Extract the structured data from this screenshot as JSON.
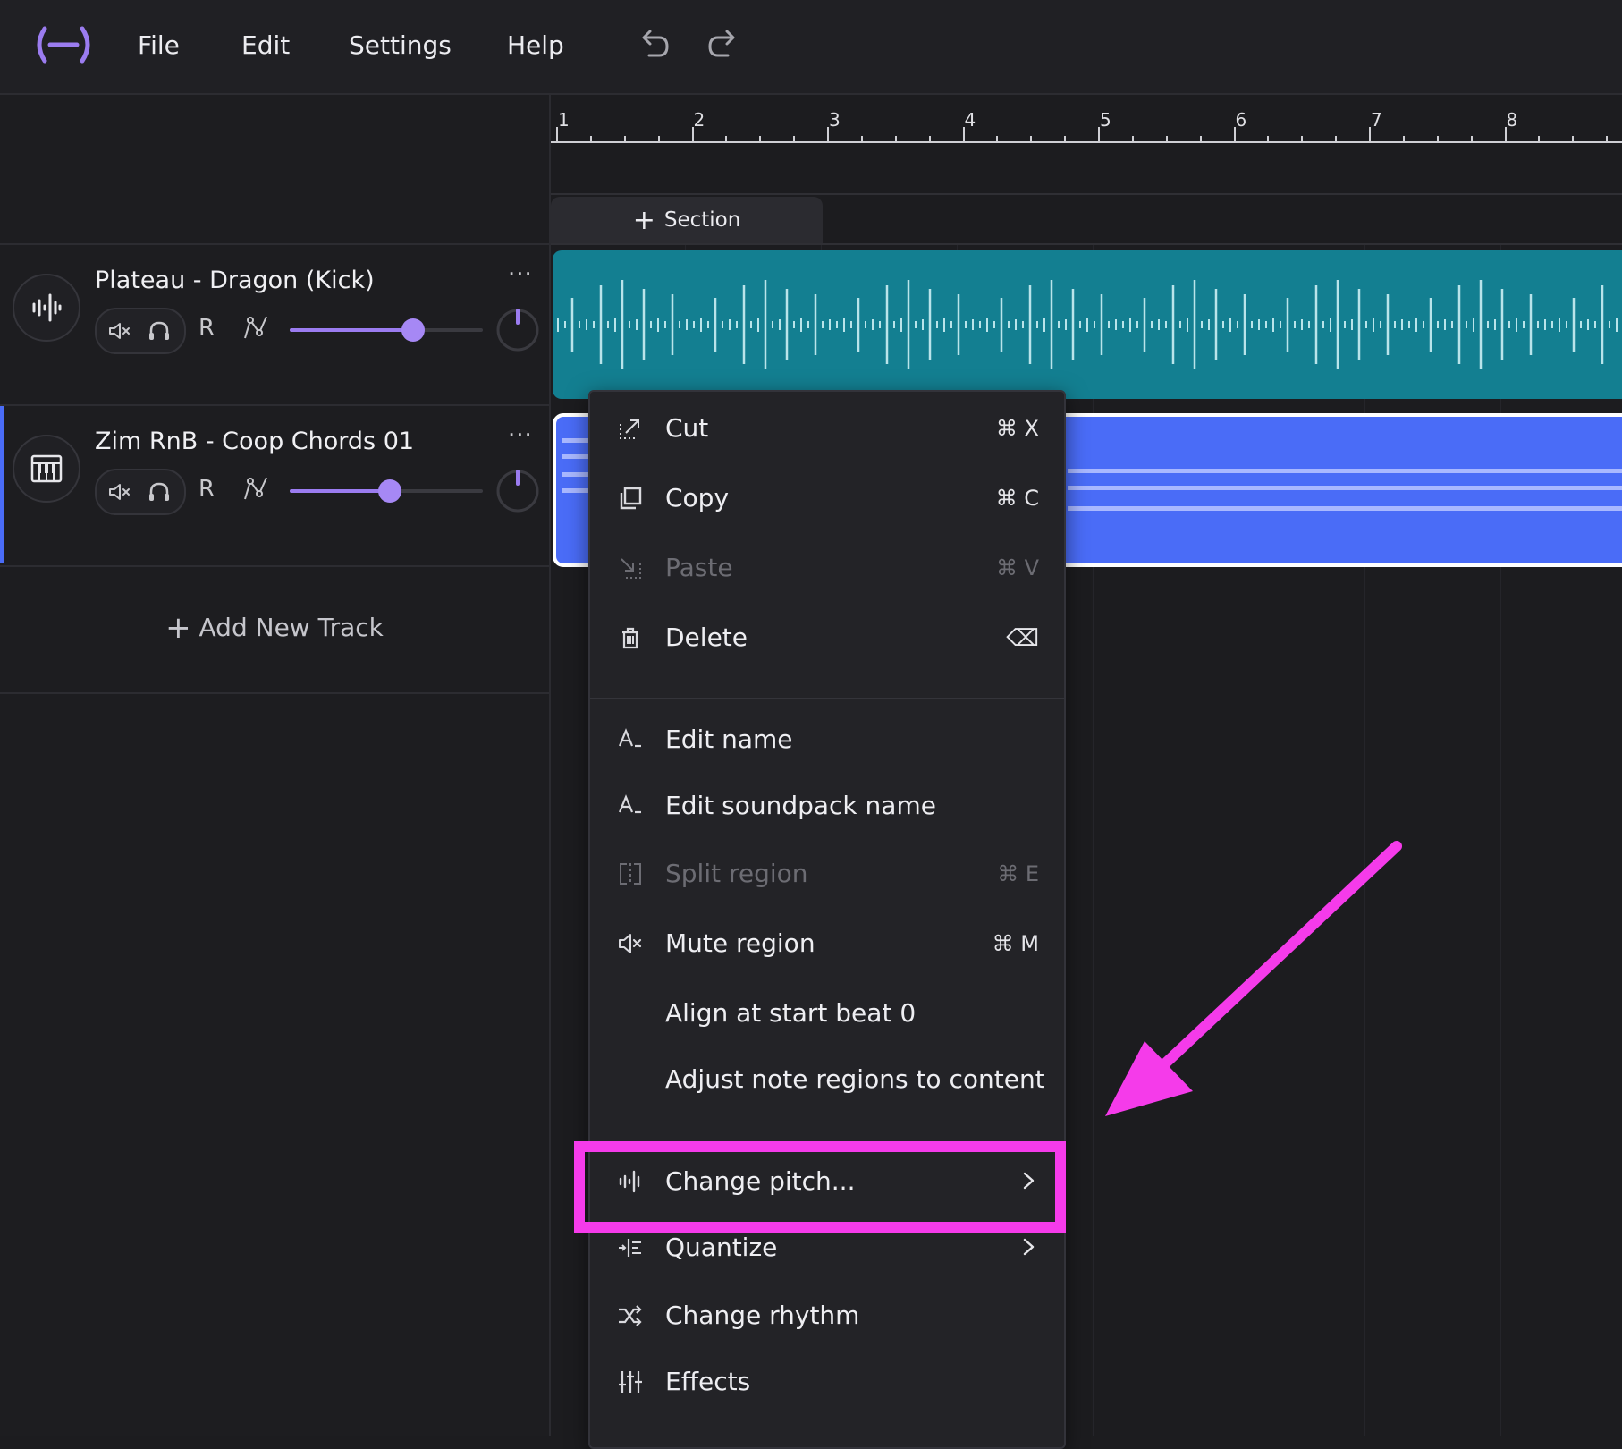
{
  "topbar": {
    "menus": [
      "File",
      "Edit",
      "Settings",
      "Help"
    ]
  },
  "tracks": [
    {
      "name": "Plateau - Dragon (Kick)",
      "icon": "waveform-icon",
      "volume": 0.64,
      "record_label": "R",
      "more": "···"
    },
    {
      "name": "Zim RnB - Coop Chords 01",
      "icon": "piano-icon",
      "volume": 0.52,
      "record_label": "R",
      "more": "···"
    }
  ],
  "add_track_label": "Add New Track",
  "ruler": {
    "bars": [
      "1",
      "2",
      "3",
      "4",
      "5",
      "6",
      "7",
      "8"
    ]
  },
  "section_label": "Section",
  "context_menu": {
    "items": [
      {
        "label": "Cut",
        "shortcut": "⌘ X",
        "icon": "cut-icon",
        "disabled": false
      },
      {
        "label": "Copy",
        "shortcut": "⌘ C",
        "icon": "copy-icon",
        "disabled": false
      },
      {
        "label": "Paste",
        "shortcut": "⌘ V",
        "icon": "paste-icon",
        "disabled": true
      },
      {
        "label": "Delete",
        "shortcut": "⌫",
        "icon": "trash-icon",
        "disabled": false
      },
      {
        "label": "Edit name",
        "shortcut": "",
        "icon": "text-edit-icon",
        "disabled": false
      },
      {
        "label": "Edit soundpack name",
        "shortcut": "",
        "icon": "text-edit-icon",
        "disabled": false
      },
      {
        "label": "Split region",
        "shortcut": "⌘ E",
        "icon": "split-icon",
        "disabled": true
      },
      {
        "label": "Mute region",
        "shortcut": "⌘ M",
        "icon": "mute-icon",
        "disabled": false
      },
      {
        "label": "Align at start beat 0",
        "shortcut": "",
        "icon": "",
        "disabled": false
      },
      {
        "label": "Adjust note regions to content",
        "shortcut": "",
        "icon": "",
        "disabled": false
      },
      {
        "label": "Change pitch...",
        "shortcut": "",
        "icon": "pitch-icon",
        "disabled": false,
        "submenu": true
      },
      {
        "label": "Quantize",
        "shortcut": "",
        "icon": "quantize-icon",
        "disabled": false,
        "submenu": true
      },
      {
        "label": "Change rhythm",
        "shortcut": "",
        "icon": "shuffle-icon",
        "disabled": false
      },
      {
        "label": "Effects",
        "shortcut": "",
        "icon": "sliders-icon",
        "disabled": false
      }
    ]
  },
  "colors": {
    "accent": "#9b7cf0",
    "kick_region": "#137f91",
    "chords_region": "#4a6cf7",
    "highlight": "#f53bea"
  }
}
